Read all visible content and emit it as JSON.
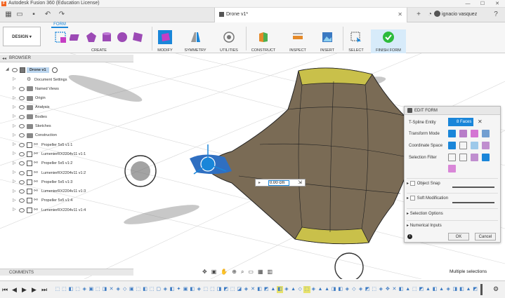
{
  "window": {
    "title": "Autodesk Fusion 360 (Education License)",
    "controls": [
      "—",
      "☐",
      "✕"
    ]
  },
  "document_tab": {
    "label": "Drone v1*"
  },
  "user": {
    "name": "ignacio vasquez"
  },
  "ribbon": {
    "workspace": "DESIGN",
    "active_tab": "FORM",
    "groups": [
      "CREATE",
      "MODIFY",
      "SYMMETRY",
      "UTILITIES",
      "CONSTRUCT",
      "INSPECT",
      "INSERT",
      "SELECT",
      "FINISH FORM"
    ]
  },
  "browser": {
    "header": "BROWSER",
    "root": "Drone v1",
    "items": [
      {
        "label": "Document Settings",
        "kind": "settings"
      },
      {
        "label": "Named Views",
        "kind": "folder"
      },
      {
        "label": "Origin",
        "kind": "folder"
      },
      {
        "label": "Analysis",
        "kind": "folder"
      },
      {
        "label": "Bodies",
        "kind": "folder"
      },
      {
        "label": "Sketches",
        "kind": "folder"
      },
      {
        "label": "Construction",
        "kind": "folder"
      },
      {
        "label": "Propeller 5x5 v1:1",
        "kind": "component"
      },
      {
        "label": "LumenierRX2204v11 v1:1",
        "kind": "component"
      },
      {
        "label": "Propeller 5x5 v1:2",
        "kind": "component"
      },
      {
        "label": "LumenierRX2204v11 v1:2",
        "kind": "component"
      },
      {
        "label": "Propeller 5x5 v1:3",
        "kind": "component"
      },
      {
        "label": "LumenierRX2204v11 v1:3",
        "kind": "component"
      },
      {
        "label": "Propeller 5x5 v1:4",
        "kind": "component"
      },
      {
        "label": "LumenierRX2204v11 v1:4",
        "kind": "component"
      }
    ]
  },
  "comments": {
    "label": "COMMENTS"
  },
  "edit_form": {
    "title": "EDIT FORM",
    "tspline_entity_label": "T-Spline Entity",
    "tspline_entity_value": "8 Faces",
    "transform_mode_label": "Transform Mode",
    "coordinate_space_label": "Coordinate Space",
    "selection_filter_label": "Selection Filter",
    "object_snap_label": "Object Snap",
    "soft_modification_label": "Soft Modification",
    "selection_options_label": "Selection Options",
    "numerical_inputs_label": "Numerical Inputs",
    "ok_label": "OK",
    "cancel_label": "Cancel"
  },
  "viewport": {
    "input_value": "0.00 cm"
  },
  "status": {
    "message": "Multiple selections"
  },
  "colors": {
    "accent": "#1a86d9",
    "surface": "#7a6b55",
    "highlight": "#c9c04a",
    "finish": "#2dbb3c"
  }
}
